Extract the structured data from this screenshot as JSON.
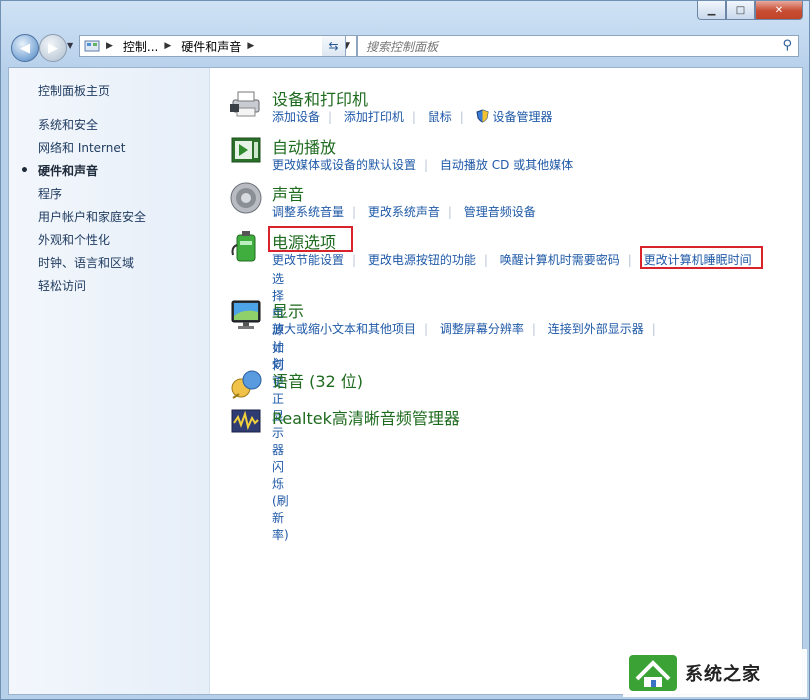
{
  "window": {
    "min_glyph": "▁",
    "max_glyph": "□",
    "close_glyph": "✕"
  },
  "address": {
    "crumb1": "控制...",
    "crumb2": "硬件和声音",
    "search_placeholder": "搜索控制面板"
  },
  "sidebar": {
    "home": "控制面板主页",
    "items": [
      {
        "label": "系统和安全"
      },
      {
        "label": "网络和 Internet"
      },
      {
        "label": "硬件和声音"
      },
      {
        "label": "程序"
      },
      {
        "label": "用户帐户和家庭安全"
      },
      {
        "label": "外观和个性化"
      },
      {
        "label": "时钟、语言和区域"
      },
      {
        "label": "轻松访问"
      }
    ]
  },
  "categories": {
    "devices": {
      "title": "设备和打印机",
      "links": [
        "添加设备",
        "添加打印机",
        "鼠标",
        "设备管理器"
      ],
      "icon": "printer-icon"
    },
    "autoplay": {
      "title": "自动播放",
      "links": [
        "更改媒体或设备的默认设置",
        "自动播放 CD 或其他媒体"
      ],
      "icon": "autoplay-icon"
    },
    "sound": {
      "title": "声音",
      "links": [
        "调整系统音量",
        "更改系统声音",
        "管理音频设备"
      ],
      "icon": "speaker-icon"
    },
    "power": {
      "title": "电源选项",
      "links": [
        "更改节能设置",
        "更改电源按钮的功能",
        "唤醒计算机时需要密码",
        "更改计算机睡眠时间",
        "选择电源计划"
      ],
      "icon": "battery-icon"
    },
    "display": {
      "title": "显示",
      "links": [
        "放大或缩小文本和其他项目",
        "调整屏幕分辨率",
        "连接到外部显示器",
        "如何更正显示器闪烁(刷新率)"
      ],
      "icon": "monitor-icon"
    },
    "language": {
      "title": "语音 (32 位)",
      "icon": "speech-icon"
    },
    "realtek": {
      "title": "Realtek高清晰音频管理器",
      "icon": "audio-manager-icon"
    }
  },
  "watermark": {
    "text": "系统之家",
    "icon": "house-logo-icon"
  },
  "colors": {
    "highlight": "#d8232a",
    "category_title": "#1e6a1e",
    "link": "#1f59a7"
  }
}
